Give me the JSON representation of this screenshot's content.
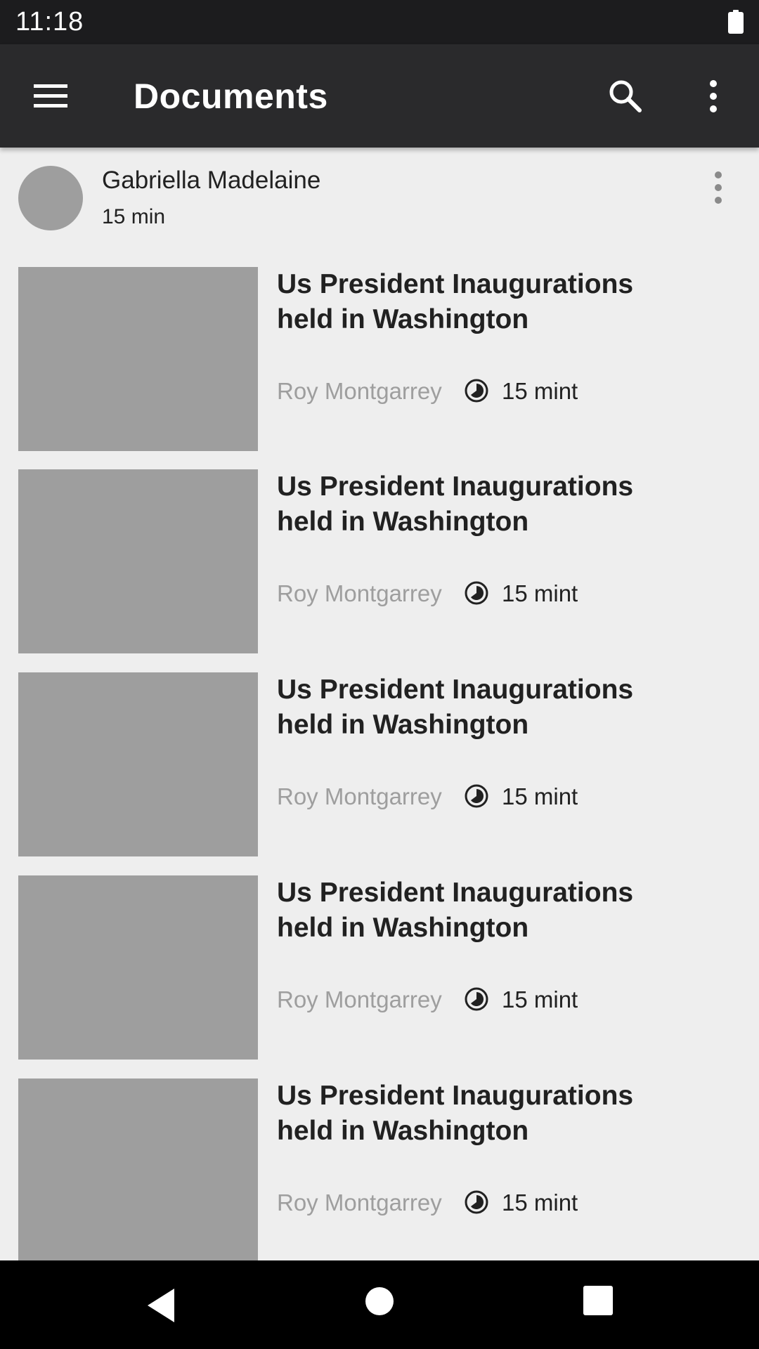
{
  "status_bar": {
    "time": "11:18"
  },
  "app_bar": {
    "title": "Documents"
  },
  "author": {
    "name": "Gabriella Madelaine",
    "time": "15 min"
  },
  "articles": [
    {
      "title_line1": "Us President Inaugurations",
      "title_line2": "held in Washington",
      "author": "Roy Montgarrey",
      "time": "15 mint"
    },
    {
      "title_line1": "Us President Inaugurations",
      "title_line2": "held in Washington",
      "author": "Roy Montgarrey",
      "time": "15 mint"
    },
    {
      "title_line1": "Us President Inaugurations",
      "title_line2": "held in Washington",
      "author": "Roy Montgarrey",
      "time": "15 mint"
    },
    {
      "title_line1": "Us President Inaugurations",
      "title_line2": "held in Washington",
      "author": "Roy Montgarrey",
      "time": "15 mint"
    },
    {
      "title_line1": "Us President Inaugurations",
      "title_line2": "held in Washington",
      "author": "Roy Montgarrey",
      "time": "15 mint"
    }
  ],
  "icons": {
    "menu": "menu-icon",
    "search": "search-icon",
    "overflow": "more-vert-icon",
    "clock": "clock-icon",
    "battery": "battery-icon",
    "back": "back-icon",
    "home": "home-icon",
    "recent": "recent-apps-icon"
  },
  "colors": {
    "status_bar": "#1c1c1e",
    "app_bar": "#2a2a2c",
    "background": "#eeeeee",
    "placeholder": "#9e9e9e",
    "text_primary": "#212121",
    "text_secondary": "#9e9e9e"
  }
}
